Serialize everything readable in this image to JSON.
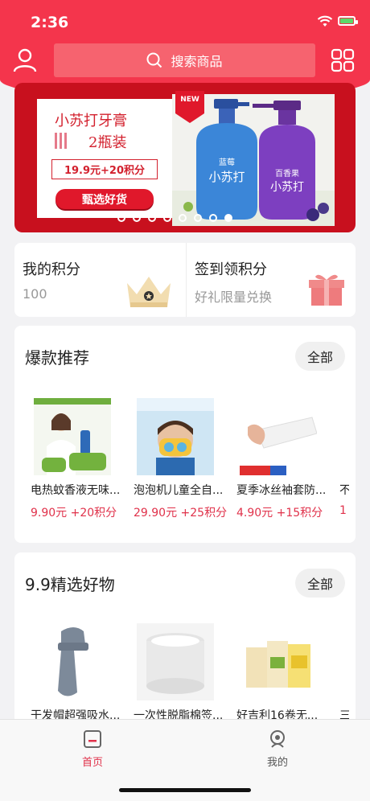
{
  "status": {
    "time": "2:36"
  },
  "header": {
    "search_placeholder": "搜索商品"
  },
  "banner": {
    "title": "小苏打牙膏",
    "subtitle": "2瓶装",
    "price": "19.9元+20积分",
    "cta": "甄选好货",
    "tag": "NEW",
    "slides": 8,
    "active_slide": 8
  },
  "points": {
    "my_points_label": "我的积分",
    "my_points_value": "100",
    "sign_label": "签到领积分",
    "sign_sub": "好礼限量兑换"
  },
  "hot": {
    "title": "爆款推荐",
    "all": "全部",
    "items": [
      {
        "name": "电热蚊香液无味...",
        "price": "9.90元 +20积分"
      },
      {
        "name": "泡泡机儿童全自...",
        "price": "29.90元 +25积分"
      },
      {
        "name": "夏季冰丝袖套防...",
        "price": "4.90元 +15积分"
      },
      {
        "name": "不",
        "price": "1"
      }
    ]
  },
  "deals": {
    "title": "9.9精选好物",
    "all": "全部",
    "items": [
      {
        "name": "干发帽超强吸水..."
      },
      {
        "name": "一次性脱脂棉签..."
      },
      {
        "name": "好吉利16卷无..."
      },
      {
        "name": "三"
      }
    ]
  },
  "tabbar": {
    "home": "首页",
    "mine": "我的"
  },
  "colors": {
    "brand": "#f4354c",
    "price": "#e0314a",
    "banner_bg": "#c8101e"
  }
}
